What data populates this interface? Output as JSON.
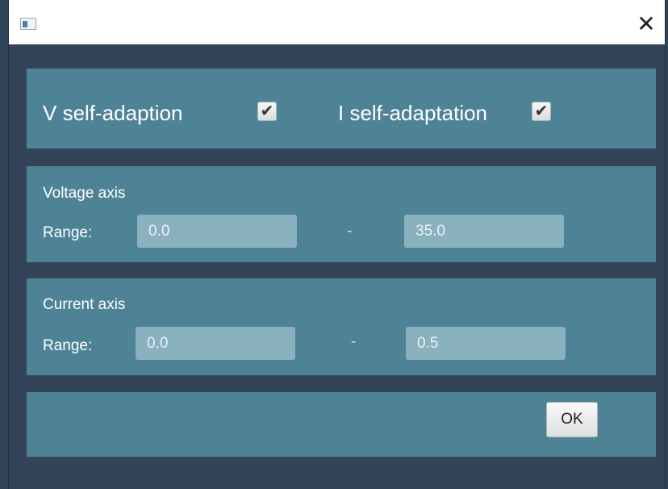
{
  "window": {
    "close_glyph": "✕"
  },
  "adaptation": {
    "v_label": "V self-adaption",
    "v_checked": true,
    "i_label": "I self-adaptation",
    "i_checked": true,
    "check_glyph": "✔"
  },
  "voltage_axis": {
    "title": "Voltage axis",
    "range_label": "Range:",
    "min_value": "0.0",
    "max_value": "35.0",
    "separator": "-"
  },
  "current_axis": {
    "title": "Current axis",
    "range_label": "Range:",
    "min_value": "0.0",
    "max_value": "0.5",
    "separator": "-"
  },
  "footer": {
    "ok_label": "OK"
  },
  "colors": {
    "background": "#334459",
    "panel": "#4e8396",
    "field": "#8ab2be"
  }
}
